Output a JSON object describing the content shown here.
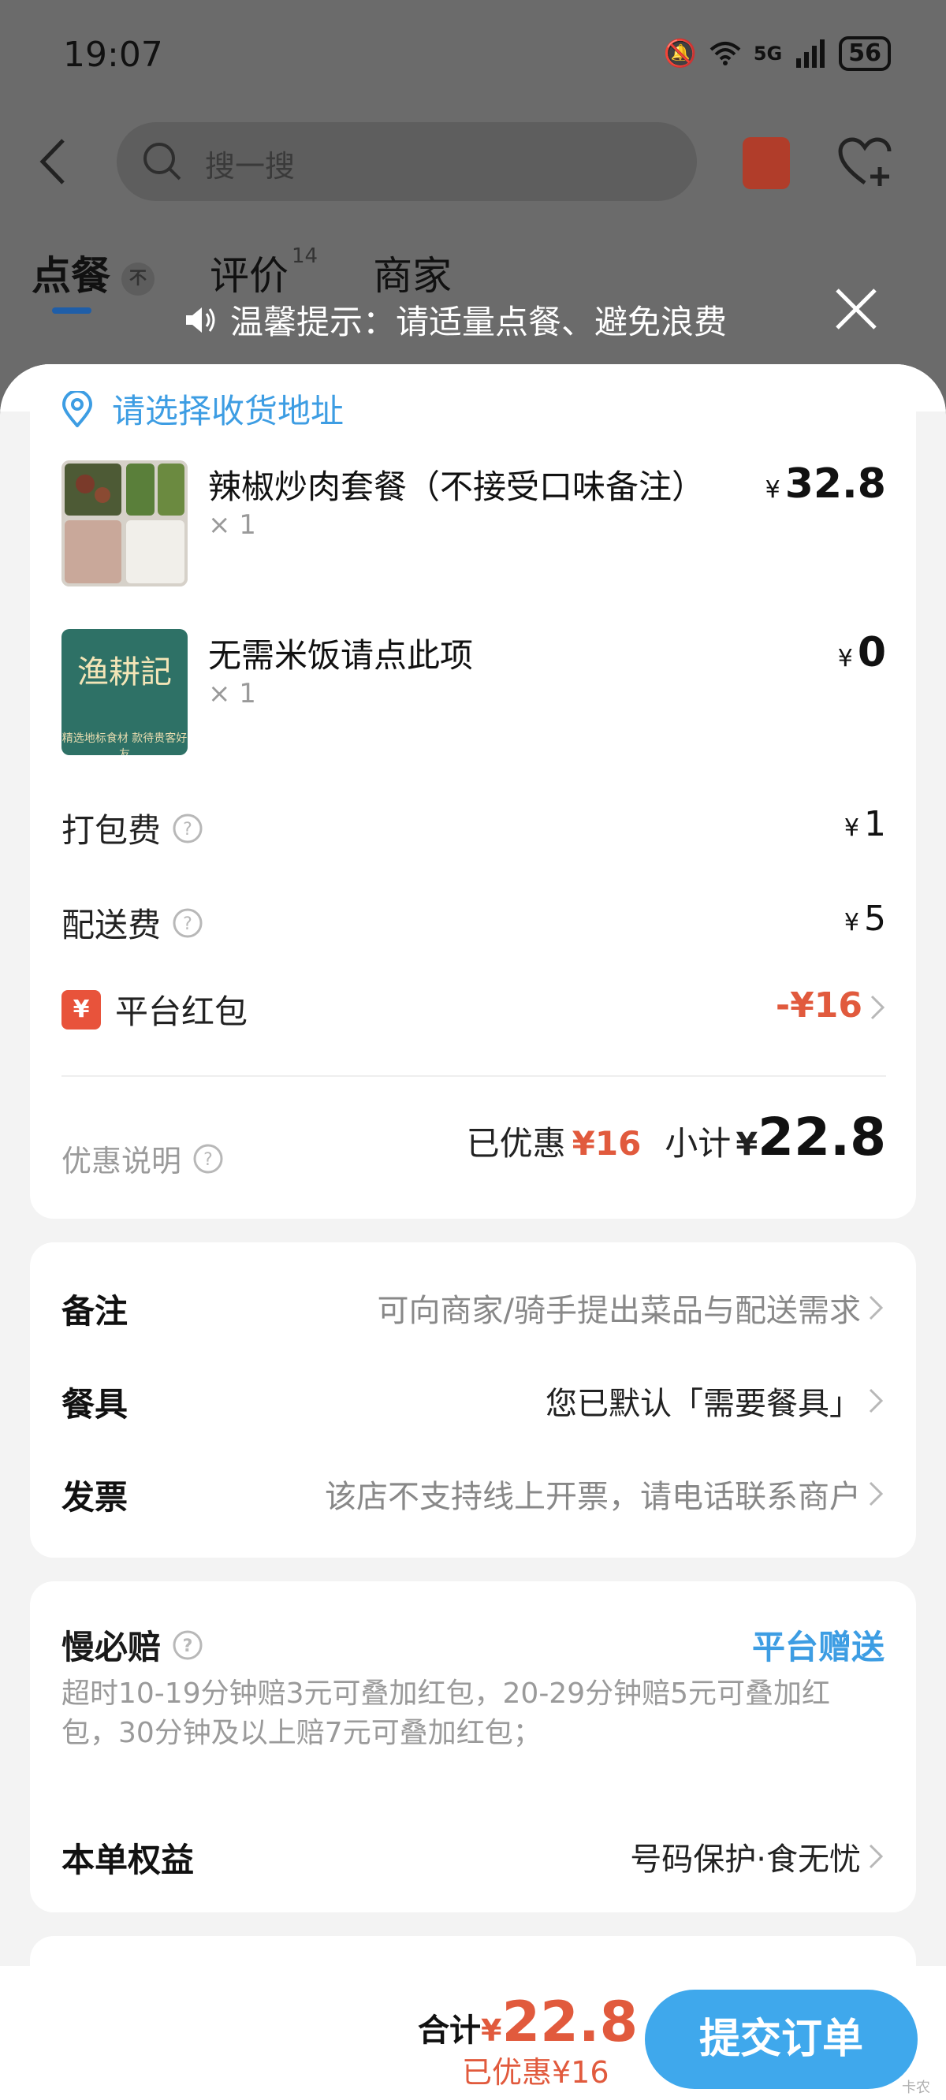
{
  "status_bar": {
    "time": "19:07",
    "network": "5G",
    "battery": "56"
  },
  "search": {
    "placeholder": "搜一搜"
  },
  "tabs": [
    {
      "label": "点餐",
      "badge": "不"
    },
    {
      "label": "评价",
      "count": "14"
    },
    {
      "label": "商家"
    }
  ],
  "tip": {
    "text": "温馨提示：请适量点餐、避免浪费"
  },
  "address": {
    "label": "请选择收货地址"
  },
  "items": [
    {
      "name": "辣椒炒肉套餐（不接受口味备注）",
      "qty": "× 1",
      "yen": "¥",
      "price": "32.8"
    },
    {
      "name": "无需米饭请点此项",
      "qty": "× 1",
      "yen": "¥",
      "price": "0",
      "thumb_text": "渔耕記",
      "thumb_sub": "精选地标食材 款待贵客好友"
    }
  ],
  "fees": {
    "packing": {
      "label": "打包费",
      "yen": "¥",
      "value": "1"
    },
    "delivery": {
      "label": "配送费",
      "yen": "¥",
      "value": "5"
    },
    "red_packet": {
      "label": "平台红包",
      "icon": "¥",
      "value": "-¥16"
    }
  },
  "summary": {
    "discount_note": "优惠说明",
    "saved_label": "已优惠",
    "saved_amount": "¥16",
    "subtotal_label": "小计",
    "subtotal_yen": "¥",
    "subtotal_amount": "22.8"
  },
  "options": {
    "note": {
      "label": "备注",
      "value": "可向商家/骑手提出菜品与配送需求"
    },
    "tableware": {
      "label": "餐具",
      "value": "您已默认「需要餐具」"
    },
    "invoice": {
      "label": "发票",
      "value": "该店不支持线上开票，请电话联系商户"
    }
  },
  "guarantee": {
    "title": "慢必赔",
    "tag": "平台赠送",
    "desc": "超时10-19分钟赔3元可叠加红包，20-29分钟赔5元可叠加红包，30分钟及以上赔7元可叠加红包；",
    "rights_label": "本单权益",
    "rights_value": "号码保护·食无忧"
  },
  "bottom": {
    "total_label": "合计",
    "total_yen": "¥",
    "total_amount": "22.8",
    "total_saved": "已优惠¥16",
    "submit": "提交订单",
    "corner": "卡农"
  },
  "colors": {
    "accent_blue": "#3fa8ec",
    "discount_red": "#e15a3d",
    "link_blue": "#3d9de3"
  }
}
